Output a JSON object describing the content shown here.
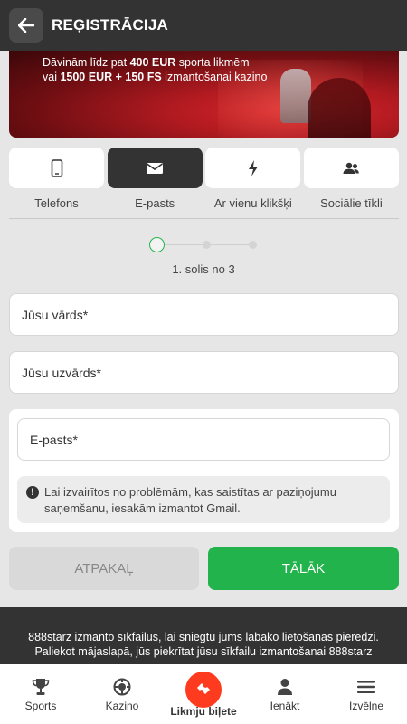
{
  "header": {
    "title": "REĢISTRĀCIJA"
  },
  "banner": {
    "line1_prefix": "Dāvinām līdz pat ",
    "line1_amount": "400 EUR",
    "line1_suffix": " sporta likmēm",
    "line2_prefix": "vai ",
    "line2_amount": "1500 EUR + 150 FS",
    "line2_suffix": " izmantošanai kazino"
  },
  "methods": [
    {
      "label": "Telefons",
      "icon": "phone-icon"
    },
    {
      "label": "E-pasts",
      "icon": "envelope-icon",
      "active": true
    },
    {
      "label": "Ar vienu klikšķi",
      "icon": "lightning-icon"
    },
    {
      "label": "Sociālie tīkli",
      "icon": "users-icon"
    }
  ],
  "stepper": {
    "text": "1. solis no 3",
    "current": 1,
    "total": 3
  },
  "form": {
    "first_name_placeholder": "Jūsu vārds*",
    "last_name_placeholder": "Jūsu uzvārds*",
    "email_placeholder": "E-pasts*",
    "notice": "Lai izvairītos no problēmām, kas saistītas ar paziņojumu saņemšanu, iesakām izmantot Gmail."
  },
  "buttons": {
    "back": "ATPAKAĻ",
    "next": "TĀLĀK"
  },
  "cookie": {
    "line1": "888starz izmanto sīkfailus, lai sniegtu jums labāko lietošanas pieredzi.",
    "line2": "Paliekot mājaslapā, jūs piekrītat jūsu sīkfailu izmantošanai 888starz"
  },
  "nav": {
    "sports": "Sports",
    "casino": "Kazino",
    "bet_slip": "Likmju biļete",
    "login": "Ienākt",
    "menu": "Izvēlne"
  },
  "colors": {
    "accent_green": "#22b34c",
    "header_dark": "#333333",
    "bet_red": "#ff3b1f"
  }
}
